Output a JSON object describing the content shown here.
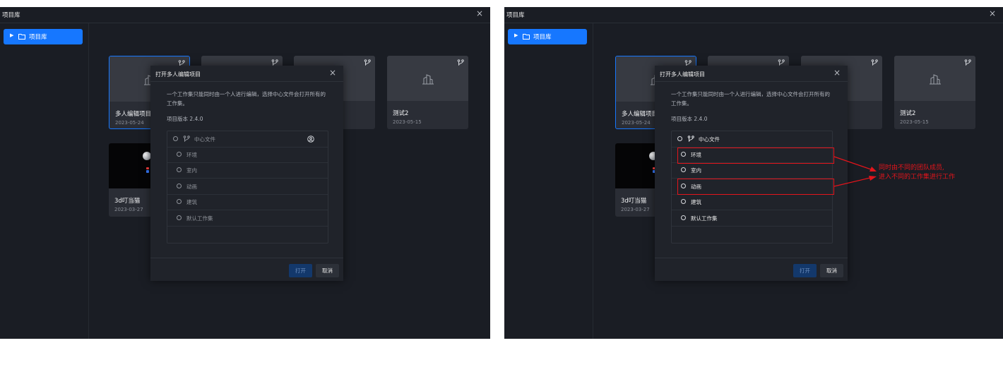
{
  "window": {
    "title": "项目库",
    "close_glyph": "×"
  },
  "sidebar": {
    "items": [
      {
        "label": "项目库",
        "icon": "folder-icon"
      }
    ]
  },
  "projects": [
    {
      "name": "多人编辑项目",
      "date": "2023-05-24",
      "selected": true
    },
    {
      "name": "",
      "date": ""
    },
    {
      "name": "",
      "date": ""
    },
    {
      "name": "测试2",
      "date": "2023-05-15"
    },
    {
      "name": "3d叮当猫",
      "date": "2023-03-27"
    }
  ],
  "dialog": {
    "title": "打开多人编辑项目",
    "description": "一个工作集只能同时由一个人进行编辑，选择中心文件会打开所有的工作集。",
    "version_label": "项目版本 2.4.0",
    "root": "中心文件",
    "worksets": [
      "环境",
      "室内",
      "动画",
      "建筑",
      "默认工作集"
    ],
    "open_button": "打开",
    "cancel_button": "取消"
  },
  "annotation": {
    "line1": "同时由不同的团队成员,",
    "line2": "进入不同的工作集进行工作",
    "highlighted": [
      "环境",
      "动画"
    ],
    "color": "#e3141b"
  },
  "colors": {
    "accent": "#1677ff",
    "background": "#1a1d24",
    "card": "#2a2d35",
    "dialog": "#20232a"
  }
}
